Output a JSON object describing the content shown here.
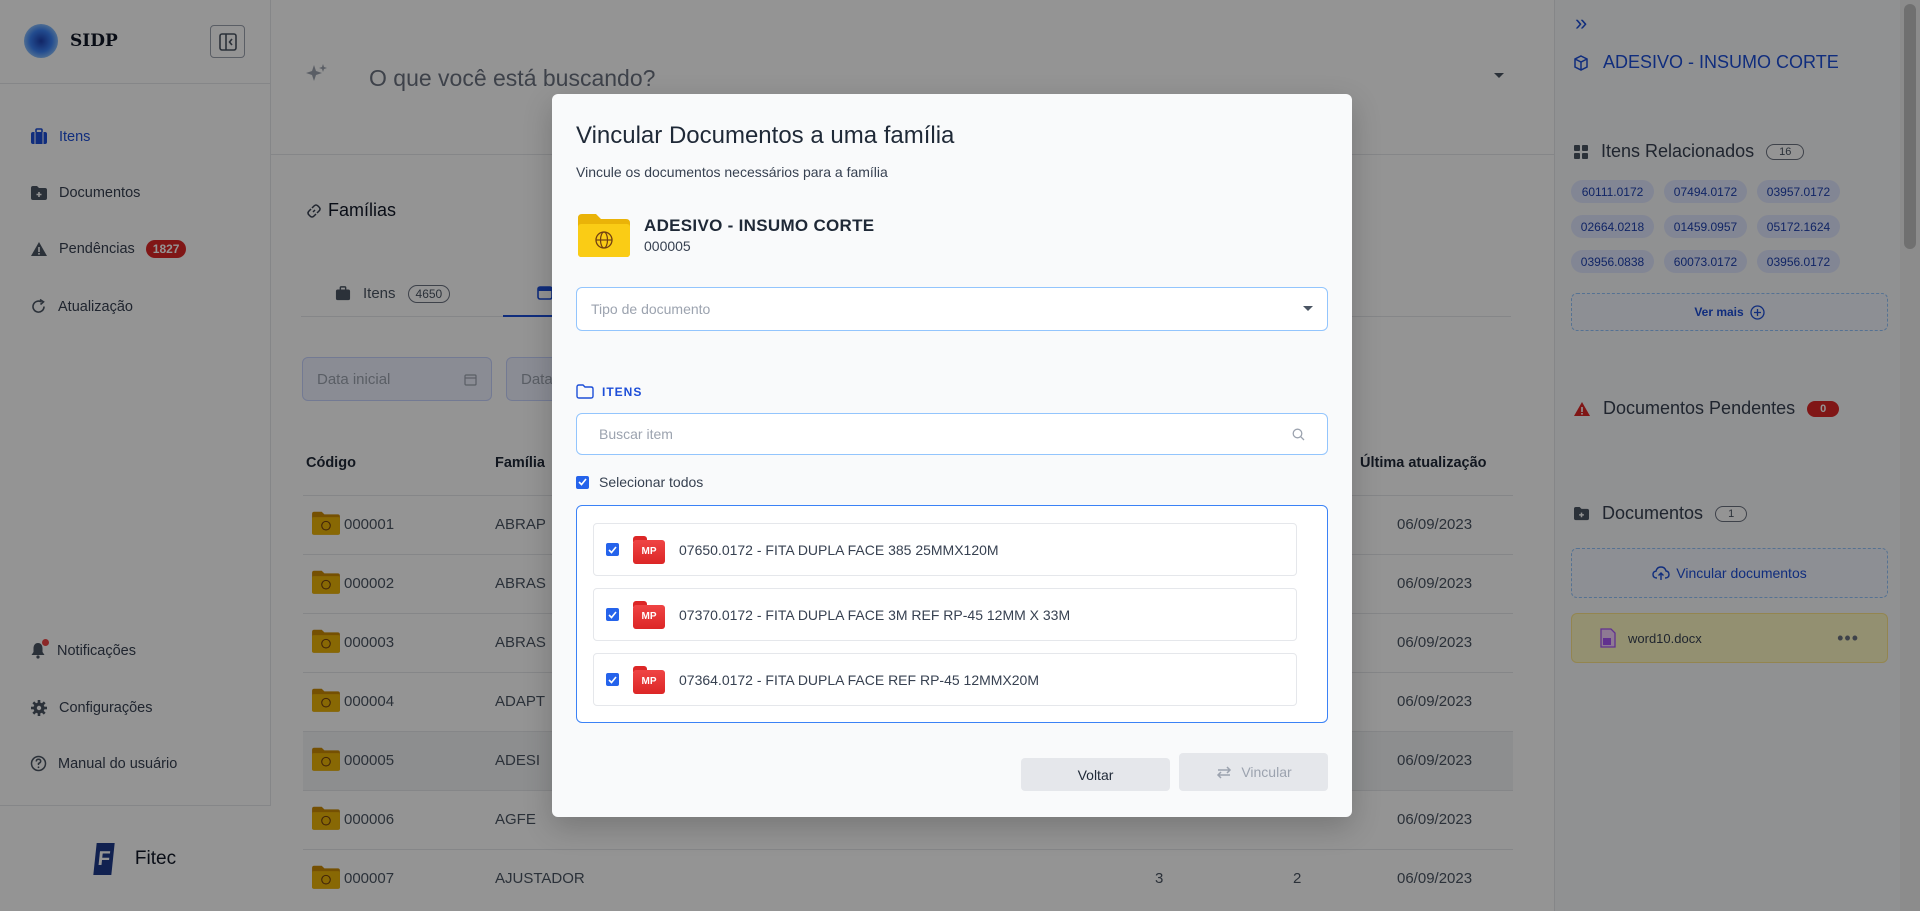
{
  "app": {
    "name": "SIDP",
    "footer_brand": "Fitec",
    "footer_logo_letter": "F"
  },
  "sidebar": {
    "items": [
      {
        "label": "Itens",
        "icon": "briefcase-icon",
        "active": true
      },
      {
        "label": "Documentos",
        "icon": "folder-plus-icon"
      },
      {
        "label": "Pendências",
        "icon": "warning-icon",
        "badge": "1827"
      },
      {
        "label": "Atualização",
        "icon": "refresh-icon"
      }
    ],
    "bottom_items": [
      {
        "label": "Notificações",
        "icon": "bell-icon"
      },
      {
        "label": "Configurações",
        "icon": "gear-icon"
      },
      {
        "label": "Manual do usuário",
        "icon": "help-icon"
      }
    ]
  },
  "search": {
    "placeholder": "O que você está buscando?"
  },
  "page": {
    "title": "Famílias",
    "tabs": [
      {
        "label": "Itens",
        "count": "4650"
      }
    ],
    "date_start_placeholder": "Data inicial",
    "date_end_placeholder": "Data",
    "table": {
      "headers": [
        "Código",
        "Família",
        "Última atualização"
      ],
      "rows": [
        {
          "code": "000001",
          "family": "ABRAP",
          "a": "",
          "b": "",
          "date": "06/09/2023"
        },
        {
          "code": "000002",
          "family": "ABRAS",
          "a": "",
          "b": "",
          "date": "06/09/2023"
        },
        {
          "code": "000003",
          "family": "ABRAS",
          "a": "",
          "b": "",
          "date": "06/09/2023"
        },
        {
          "code": "000004",
          "family": "ADAPT",
          "a": "",
          "b": "",
          "date": "06/09/2023"
        },
        {
          "code": "000005",
          "family": "ADESI",
          "a": "",
          "b": "",
          "date": "06/09/2023"
        },
        {
          "code": "000006",
          "family": "AGFE",
          "a": "",
          "b": "",
          "date": "06/09/2023"
        },
        {
          "code": "000007",
          "family": "AJUSTADOR",
          "a": "3",
          "b": "2",
          "date": "06/09/2023"
        }
      ]
    }
  },
  "right_panel": {
    "title": "ADESIVO - INSUMO CORTE",
    "related_title": "Itens Relacionados",
    "related_count": "16",
    "related_items": [
      "60111.0172",
      "07494.0172",
      "03957.0172",
      "02664.0218",
      "01459.0957",
      "05172.1624",
      "03956.0838",
      "60073.0172",
      "03956.0172"
    ],
    "see_more": "Ver mais",
    "pending_title": "Documentos Pendentes",
    "pending_count": "0",
    "docs_title": "Documentos",
    "docs_count": "1",
    "link_docs_label": "Vincular documentos",
    "doc_file": "word10.docx"
  },
  "modal": {
    "title": "Vincular Documentos a uma família",
    "subtitle": "Vincule os documentos necessários para a família",
    "family_name": "ADESIVO - INSUMO CORTE",
    "family_code": "000005",
    "doc_type_placeholder": "Tipo de documento",
    "section_label": "ITENS",
    "item_search_placeholder": "Buscar item",
    "select_all_label": "Selecionar todos",
    "items": [
      {
        "badge": "MP",
        "label": "07650.0172 - FITA DUPLA FACE 385 25MMX120M",
        "checked": true
      },
      {
        "badge": "MP",
        "label": "07370.0172 - FITA DUPLA FACE 3M REF RP-45 12MM X 33M",
        "checked": true
      },
      {
        "badge": "MP",
        "label": "07364.0172 - FITA DUPLA FACE REF RP-45 12MMX20M",
        "checked": true
      }
    ],
    "back_label": "Voltar",
    "link_label": "Vincular"
  },
  "colors": {
    "accent": "#1d4ed8",
    "danger": "#dc2626",
    "overlay": "rgba(0,0,0,0.42)"
  }
}
